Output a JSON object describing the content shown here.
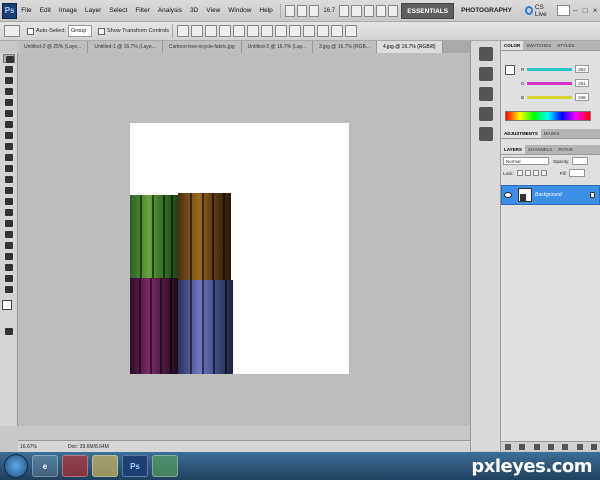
{
  "app": {
    "logo": "Ps",
    "menu": [
      "File",
      "Edit",
      "Image",
      "Layer",
      "Select",
      "Filter",
      "Analysis",
      "3D",
      "View",
      "Window",
      "Help"
    ],
    "zoom": "16.7",
    "workspaces": [
      "ESSENTIALS",
      "PHOTOGRAPHY"
    ],
    "cs_live": "CS Live"
  },
  "options_bar": {
    "auto_select_label": "Auto-Select:",
    "auto_select_value": "Group",
    "transform_label": "Show Transform Controls"
  },
  "doc_tabs": [
    "Untitled-2 @ 25% (Laye...",
    "Untitled-1 @ 16.7% (Laye...",
    "Cartoon-tree-ricycle-fabric.jpg",
    "Untitled-3 @ 16.7% (Lay...",
    "3.jpg @ 16.7% (RGB...",
    "4.jpg @ 16.7% (RGB/8)"
  ],
  "active_doc_tab_index": 5,
  "status": {
    "zoom": "16.67%",
    "doc": "Doc: 39.6M/8.64M"
  },
  "color_panel": {
    "tabs": [
      "COLOR",
      "SWATCHES",
      "STYLES"
    ],
    "sliders": [
      {
        "label": "R",
        "value": "252",
        "color": "#27c6c6"
      },
      {
        "label": "G",
        "value": "251",
        "color": "#d632c7"
      },
      {
        "label": "B",
        "value": "246",
        "color": "#d6d62c"
      }
    ]
  },
  "adjustments_panel": {
    "tabs": [
      "ADJUSTMENTS",
      "MASKS"
    ]
  },
  "layers_panel": {
    "tabs": [
      "LAYERS",
      "CHANNELS",
      "PATHS"
    ],
    "blend_mode": "Normal",
    "opacity_label": "Opacity:",
    "lock_label": "Lock:",
    "fill_label": "Fill:",
    "layer_name": "Background"
  },
  "taskbar": {
    "apps": [
      "e",
      "",
      "",
      "Ps",
      ""
    ],
    "watermark": "pxleyes.com"
  }
}
